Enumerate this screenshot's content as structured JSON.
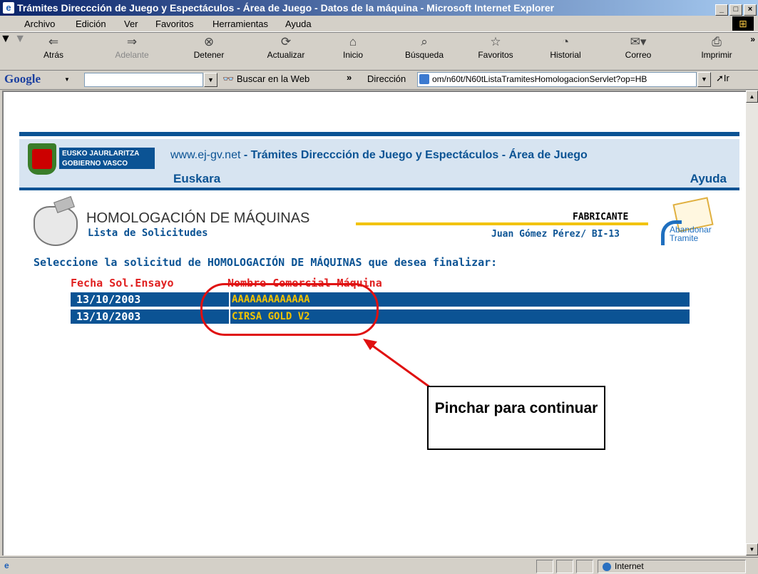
{
  "window": {
    "title": "Trámites Direccción de Juego y Espectáculos - Área de Juego - Datos de la máquina - Microsoft Internet Explorer"
  },
  "menu": [
    "Archivo",
    "Edición",
    "Ver",
    "Favoritos",
    "Herramientas",
    "Ayuda"
  ],
  "toolbar": {
    "back": "Atrás",
    "forward": "Adelante",
    "stop": "Detener",
    "refresh": "Actualizar",
    "home": "Inicio",
    "search": "Búsqueda",
    "favorites": "Favoritos",
    "history": "Historial",
    "mail": "Correo",
    "print": "Imprimir"
  },
  "google_bar": {
    "brand": "Google",
    "search_button": "Buscar en la Web"
  },
  "address": {
    "label": "Dirección",
    "url": "om/n60t/N60tListaTramitesHomologacionServlet?op=HB",
    "go": "Ir"
  },
  "status": {
    "zone": "Internet"
  },
  "site": {
    "govt_line1": "EUSKO JAURLARITZA",
    "govt_line2": "GOBIERNO VASCO",
    "portal": "www.ej-gv.net",
    "separator": " - ",
    "section_title": "Trámites Direccción de Juego y Espectáculos - Área de Juego",
    "lang_link": "Euskara",
    "help_link": "Ayuda"
  },
  "page": {
    "title": "HOMOLOGACIÓN DE MÁQUINAS",
    "subtitle": "Lista de Solicitudes",
    "role": "FABRICANTE",
    "user": "Juan Gómez Pérez/ BI-13",
    "abandon_line1": "Abandonar",
    "abandon_line2": "Tramite",
    "prompt": "Seleccione la solicitud de HOMOLOGACIÓN DE MÁQUINAS  que desea finalizar:"
  },
  "table": {
    "headers": [
      "Fecha Sol.Ensayo",
      "Nombre Comercial Máquina"
    ],
    "rows": [
      {
        "date": "13/10/2003",
        "name": "AAAAAAAAAAAAA"
      },
      {
        "date": "13/10/2003",
        "name": "CIRSA GOLD V2"
      }
    ]
  },
  "annotation": {
    "note": "Pinchar para continuar",
    "color": "#e01010"
  },
  "colors": {
    "primary": "#0b5394",
    "accent": "#f2c300",
    "header_band": "#d7e4f1"
  }
}
